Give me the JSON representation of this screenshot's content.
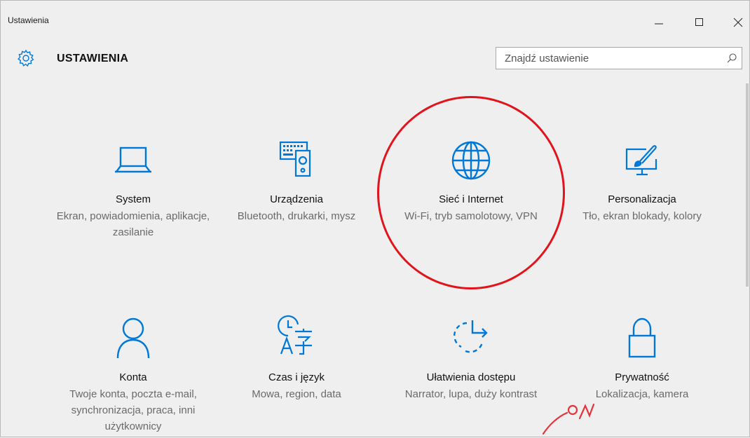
{
  "window": {
    "title": "Ustawienia",
    "controls": [
      "minimize",
      "maximize",
      "close"
    ]
  },
  "header": {
    "app_title": "USTAWIENIA",
    "icon": "gear-icon",
    "search": {
      "value": "",
      "placeholder": "Znajdź ustawienie",
      "icon": "search-icon"
    }
  },
  "accent_color": "#0078d7",
  "highlight_color": "#e1141c",
  "tiles": [
    {
      "name": "System",
      "desc": "Ekran, powiadomienia, aplikacje, zasilanie",
      "icon": "laptop-icon"
    },
    {
      "name": "Urządzenia",
      "desc": "Bluetooth, drukarki, mysz",
      "icon": "devices-icon"
    },
    {
      "name": "Sieć i Internet",
      "desc": "Wi-Fi, tryb samolotowy, VPN",
      "icon": "globe-icon"
    },
    {
      "name": "Personalizacja",
      "desc": "Tło, ekran blokady, kolory",
      "icon": "personalization-icon"
    },
    {
      "name": "Konta",
      "desc": "Twoje konta, poczta e-mail, synchronizacja, praca, inni użytkownicy",
      "icon": "person-icon"
    },
    {
      "name": "Czas i język",
      "desc": "Mowa, region, data",
      "icon": "time-language-icon"
    },
    {
      "name": "Ułatwienia dostępu",
      "desc": "Narrator, lupa, duży kontrast",
      "icon": "ease-of-access-icon"
    },
    {
      "name": "Prywatność",
      "desc": "Lokalizacja, kamera",
      "icon": "lock-icon"
    }
  ]
}
